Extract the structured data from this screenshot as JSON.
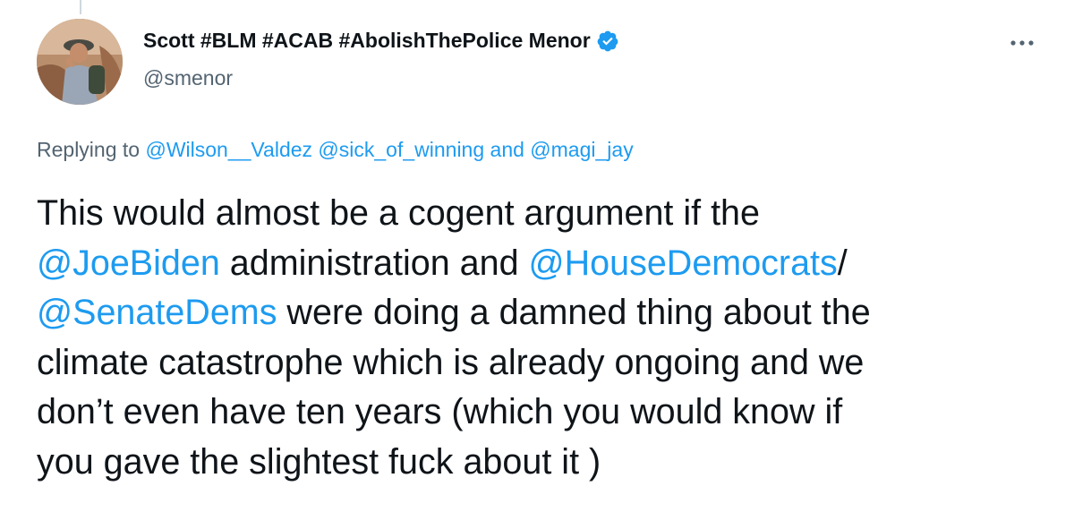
{
  "author": {
    "display_name": "Scott #BLM #ACAB #AbolishThePolice Menor",
    "handle": "@smenor",
    "verified": true
  },
  "reply_context": {
    "prefix": "Replying to",
    "mention_1": "@Wilson__Valdez",
    "mention_2": "@sick_of_winning",
    "conjunction": "and",
    "mention_3": "@magi_jay"
  },
  "tweet": {
    "line1": "This would almost be a cogent argument if the",
    "line2_mention": "@JoeBiden",
    "line2_text": " administration and ",
    "line2_mention2": "@HouseDemocrats",
    "line2_tail": "/",
    "line3_mention": "@SenateDems",
    "line3_text": " were doing a damned thing about the",
    "line4": "climate catastrophe which is already ongoing and we",
    "line5": "don’t even have ten years (which you would know if",
    "line6": "you gave the slightest fuck about it )"
  },
  "colors": {
    "link": "#1d9bf0",
    "secondary_text": "#536471",
    "primary_text": "#0f1419",
    "verified_badge": "#1d9bf0"
  },
  "icons": {
    "verified": "verified-badge-icon",
    "more": "more-options-icon"
  }
}
